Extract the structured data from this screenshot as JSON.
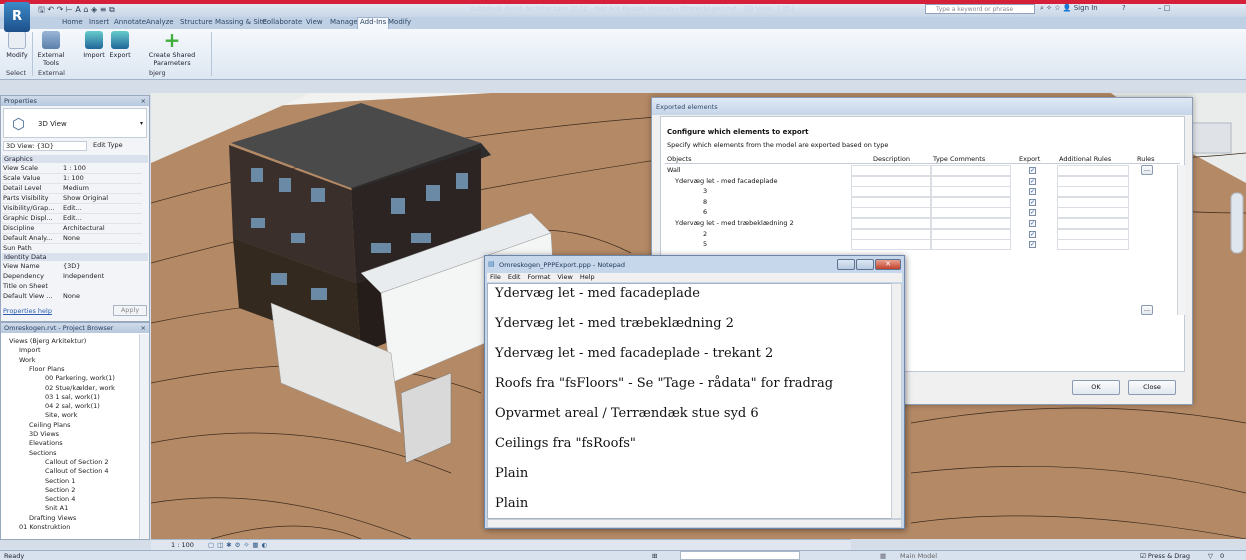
{
  "app": {
    "button_label": "R",
    "title": "Autodesk Revit Architecture 2012 - Not For Resale Version - Omreskogen.rvt - 3D View: {3D}",
    "search_placeholder": "Type a keyword or phrase",
    "sign_in": "Sign In",
    "help": "?"
  },
  "ribbon": {
    "tabs": [
      "Home",
      "Insert",
      "Annotate",
      "Analyze",
      "Structure",
      "Massing & Site",
      "Collaborate",
      "View",
      "Manage",
      "Add-Ins",
      "Modify"
    ],
    "active_tab": "Add-Ins",
    "buttons": {
      "modify": "Modify",
      "external_tools": "External Tools",
      "import": "Import",
      "export": "Export",
      "create_shared": "Create Shared Parameters"
    },
    "groups": {
      "select": "Select",
      "external": "External",
      "bjerg": "bjerg"
    }
  },
  "properties": {
    "header": "Properties",
    "type_name": "3D View",
    "view_selector": "3D View: {3D}",
    "edit_type": "Edit Type",
    "section_graphics": "Graphics",
    "rows": [
      {
        "label": "View Scale",
        "value": "1 : 100"
      },
      {
        "label": "Scale Value",
        "value": "1:  100"
      },
      {
        "label": "Detail Level",
        "value": "Medium"
      },
      {
        "label": "Parts Visibility",
        "value": "Show Original"
      },
      {
        "label": "Visibility/Grap...",
        "value": "Edit..."
      },
      {
        "label": "Graphic Displ...",
        "value": "Edit..."
      },
      {
        "label": "Discipline",
        "value": "Architectural"
      },
      {
        "label": "Default Analy...",
        "value": "None"
      },
      {
        "label": "Sun Path",
        "value": ""
      }
    ],
    "section_identity": "Identity Data",
    "identity_rows": [
      {
        "label": "View Name",
        "value": "{3D}"
      },
      {
        "label": "Dependency",
        "value": "Independent"
      },
      {
        "label": "Title on Sheet",
        "value": ""
      },
      {
        "label": "Default View ...",
        "value": "None"
      }
    ],
    "help": "Properties help",
    "apply": "Apply"
  },
  "browser": {
    "header": "Omreskogen.rvt - Project Browser",
    "items": [
      "Views (Bjerg Arkitektur)",
      "Import",
      "Work",
      "Floor Plans",
      "00 Parkering, work(1)",
      "02 Stue/kælder, work",
      "03 1 sal, work(1)",
      "04 2 sal, work(1)",
      "Site, work",
      "Ceiling Plans",
      "3D Views",
      "Elevations",
      "Sections",
      "Callout of Section 2",
      "Callout of Section 4",
      "Section 1",
      "Section 2",
      "Section 4",
      "Snit A1",
      "Drafting Views",
      "01 Konstruktion"
    ]
  },
  "viewbar": {
    "scale": "1 : 100"
  },
  "status": {
    "left": "Ready",
    "model": "Main Model",
    "press_drag": "Press & Drag",
    "filter": "0"
  },
  "dialog": {
    "title": "Exported elements",
    "heading": "Configure which elements to export",
    "subheading": "Specify which elements from the model are exported based on type",
    "columns": [
      "Objects",
      "Description",
      "Type Comments",
      "Export",
      "Additional Rules",
      "Rules"
    ],
    "rows": [
      {
        "label": "Wall",
        "indent": 0
      },
      {
        "label": "Ydervæg let - med facadeplade",
        "indent": 1
      },
      {
        "label": "3",
        "indent": 2
      },
      {
        "label": "8",
        "indent": 2
      },
      {
        "label": "6",
        "indent": 2
      },
      {
        "label": "Ydervæg let - med træbeklædning 2",
        "indent": 1
      },
      {
        "label": "2",
        "indent": 2
      },
      {
        "label": "5",
        "indent": 2
      }
    ],
    "rules_button": "...",
    "check": "✓",
    "ok": "OK",
    "close": "Close"
  },
  "notepad": {
    "title": "Omreskogen_PPPExport.ppp - Notepad",
    "menu": [
      "File",
      "Edit",
      "Format",
      "View",
      "Help"
    ],
    "lines": [
      "Ydervæg let - med facadeplade",
      "Ydervæg let - med træbeklædning 2",
      "Ydervæg let - med facadeplade - trekant 2",
      "Roofs fra \"fsFloors\" - Se \"Tage - rådata\" for fradrag",
      "Opvarmet areal / Terrændæk stue syd 6",
      "Ceilings fra \"fsRoofs\"",
      "Plain",
      "Plain"
    ]
  }
}
